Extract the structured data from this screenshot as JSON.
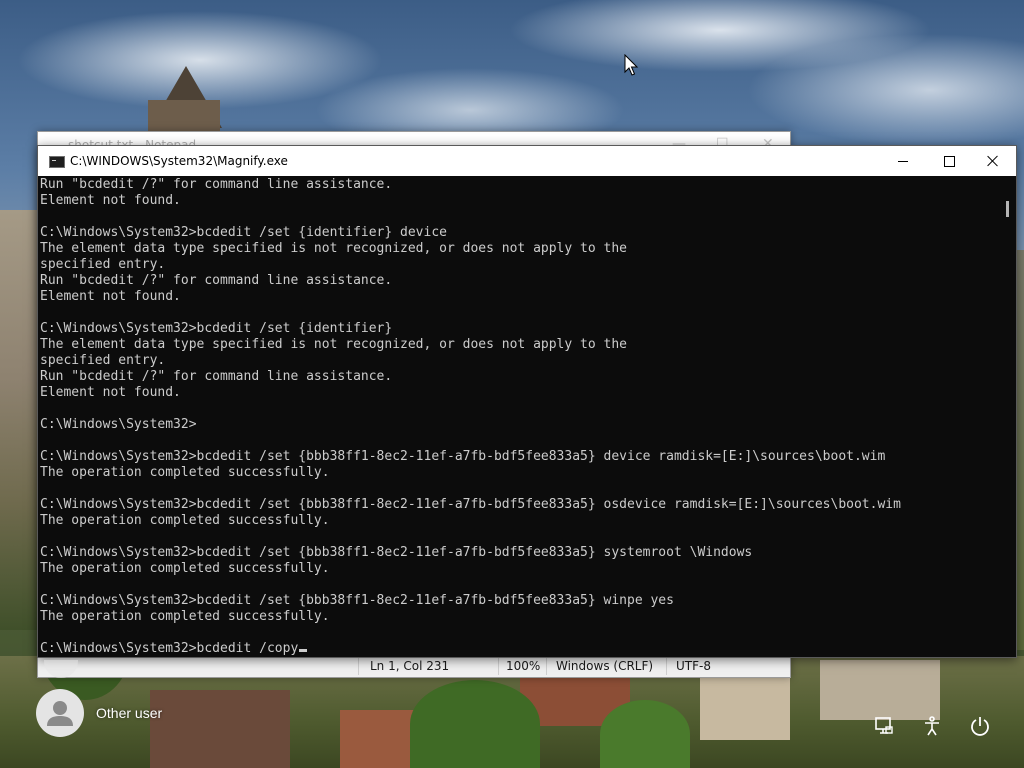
{
  "notepad": {
    "title": "shotcut.txt - Notepad",
    "status": {
      "position": "Ln 1, Col 231",
      "zoom": "100%",
      "line_ending": "Windows (CRLF)",
      "encoding": "UTF-8"
    }
  },
  "console": {
    "title": "C:\\WINDOWS\\System32\\Magnify.exe",
    "lines": [
      "Run \"bcdedit /?\" for command line assistance.",
      "Element not found.",
      "",
      "C:\\Windows\\System32>bcdedit /set {identifier} device",
      "The element data type specified is not recognized, or does not apply to the",
      "specified entry.",
      "Run \"bcdedit /?\" for command line assistance.",
      "Element not found.",
      "",
      "C:\\Windows\\System32>bcdedit /set {identifier}",
      "The element data type specified is not recognized, or does not apply to the",
      "specified entry.",
      "Run \"bcdedit /?\" for command line assistance.",
      "Element not found.",
      "",
      "C:\\Windows\\System32>",
      "",
      "C:\\Windows\\System32>bcdedit /set {bbb38ff1-8ec2-11ef-a7fb-bdf5fee833a5} device ramdisk=[E:]\\sources\\boot.wim",
      "The operation completed successfully.",
      "",
      "C:\\Windows\\System32>bcdedit /set {bbb38ff1-8ec2-11ef-a7fb-bdf5fee833a5} osdevice ramdisk=[E:]\\sources\\boot.wim",
      "The operation completed successfully.",
      "",
      "C:\\Windows\\System32>bcdedit /set {bbb38ff1-8ec2-11ef-a7fb-bdf5fee833a5} systemroot \\Windows",
      "The operation completed successfully.",
      "",
      "C:\\Windows\\System32>bcdedit /set {bbb38ff1-8ec2-11ef-a7fb-bdf5fee833a5} winpe yes",
      "The operation completed successfully.",
      "",
      "C:\\Windows\\System32>bcdedit /copy"
    ]
  },
  "login": {
    "user_name": "Other user"
  },
  "icons": {
    "console": "console-icon",
    "minimize": "minimize-icon",
    "maximize": "maximize-icon",
    "close": "close-icon",
    "network": "network-icon",
    "accessibility": "accessibility-icon",
    "power": "power-icon",
    "user": "user-avatar-icon"
  },
  "colors": {
    "console_bg": "#0c0c0c",
    "console_text": "#cccccc",
    "titlebar_bg": "#ffffff"
  }
}
